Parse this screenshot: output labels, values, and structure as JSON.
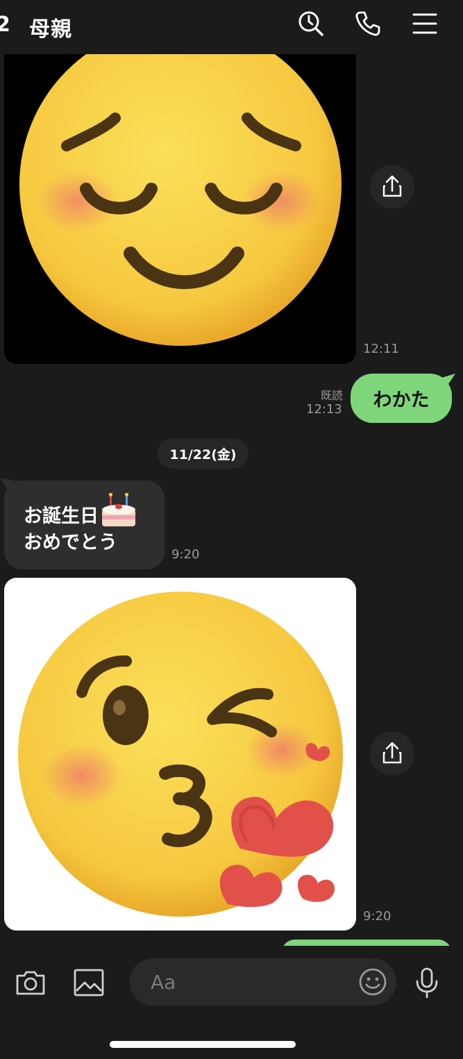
{
  "header": {
    "back_count": "2",
    "title": "母親",
    "icons": [
      "search-icon",
      "phone-icon",
      "menu-icon"
    ]
  },
  "messages": [
    {
      "type": "image",
      "content": "relieved-face-emoji",
      "time": "12:11"
    },
    {
      "type": "text-out",
      "text": "わかた",
      "read_label": "既読",
      "time": "12:13"
    },
    {
      "type": "date",
      "text": "11/22(金)"
    },
    {
      "type": "text-in",
      "line1": "お誕生日",
      "line2": "おめでとう",
      "emoji": "🎂",
      "time": "9:20"
    },
    {
      "type": "image",
      "content": "face-blowing-kiss-emoji",
      "time": "9:20"
    }
  ],
  "input": {
    "placeholder": "Aa",
    "icons": [
      "camera-icon",
      "image-icon",
      "emoji-icon",
      "microphone-icon"
    ]
  },
  "colors": {
    "background": "#1b1b1c",
    "outgoing_bubble": "#7fd67a",
    "incoming_bubble": "#2e2e2f",
    "timestamp": "#9a9a9a"
  }
}
